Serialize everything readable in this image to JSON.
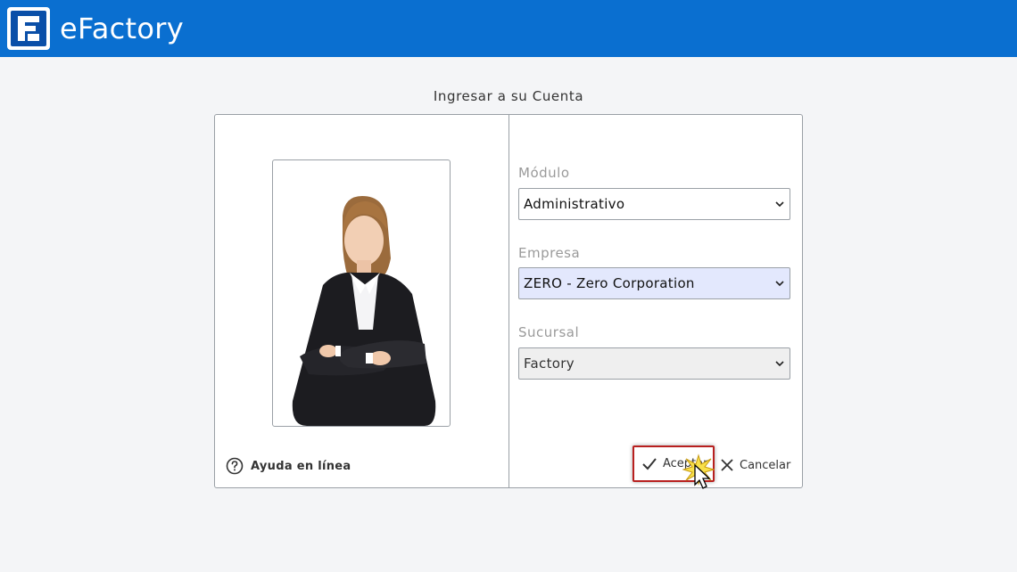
{
  "header": {
    "app_title": "eFactory",
    "logo_icon": "efactory-logo",
    "bar_color": "#0a6fd0"
  },
  "dialog": {
    "title": "Ingresar a su Cuenta",
    "help_label": "Ayuda en línea",
    "fields": {
      "modulo": {
        "label": "Módulo",
        "value": "Administrativo"
      },
      "empresa": {
        "label": "Empresa",
        "value": "ZERO - Zero Corporation"
      },
      "sucursal": {
        "label": "Sucursal",
        "value": "Factory"
      }
    },
    "buttons": {
      "accept_label": "Aceptar",
      "cancel_label": "Cancelar"
    },
    "accent_border_color": "#b8201f"
  }
}
